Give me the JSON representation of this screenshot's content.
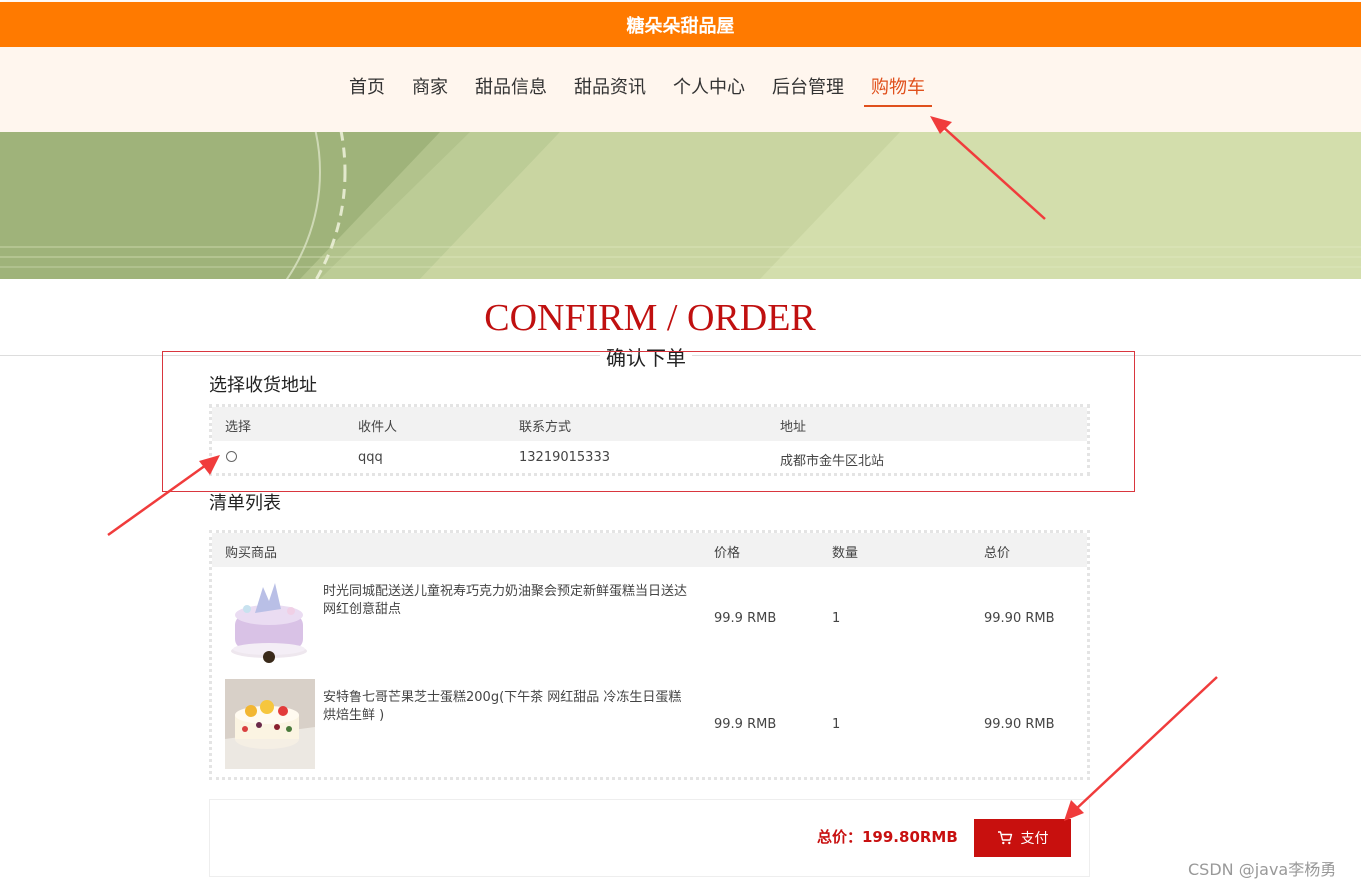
{
  "header": {
    "brand": "糖朵朵甜品屋"
  },
  "nav": {
    "items": [
      {
        "label": "首页"
      },
      {
        "label": "商家"
      },
      {
        "label": "甜品信息"
      },
      {
        "label": "甜品资讯"
      },
      {
        "label": "个人中心"
      },
      {
        "label": "后台管理"
      },
      {
        "label": "购物车",
        "active": true
      }
    ]
  },
  "page": {
    "heading": "CONFIRM / ORDER",
    "subheading": "确认下单"
  },
  "address": {
    "title": "选择收货地址",
    "headers": [
      "选择",
      "收件人",
      "联系方式",
      "地址"
    ],
    "rows": [
      {
        "recipient": "qqq",
        "phone": "13219015333",
        "address": "成都市金牛区北站",
        "selected": false
      }
    ]
  },
  "cart": {
    "title": "清单列表",
    "headers": [
      "购买商品",
      "价格",
      "数量",
      "总价"
    ],
    "items": [
      {
        "name": "时光同城配送送儿童祝寿巧克力奶油聚会预定新鲜蛋糕当日送达网红创意甜点",
        "price": "99.9 RMB",
        "qty": "1",
        "total": "99.90 RMB"
      },
      {
        "name": "安特鲁七哥芒果芝士蛋糕200g(下午茶 网红甜品 冷冻生日蛋糕烘焙生鲜 )",
        "price": "99.9 RMB",
        "qty": "1",
        "total": "99.90 RMB"
      }
    ]
  },
  "summary": {
    "total_label": "总价：199.80RMB",
    "pay_label": "支付"
  },
  "watermark": "CSDN @java李杨勇",
  "colors": {
    "topbar": "#ff7a00",
    "accent": "#c8100e",
    "nav_active": "#e0501c",
    "annotation_arrow": "#f03c3c"
  }
}
